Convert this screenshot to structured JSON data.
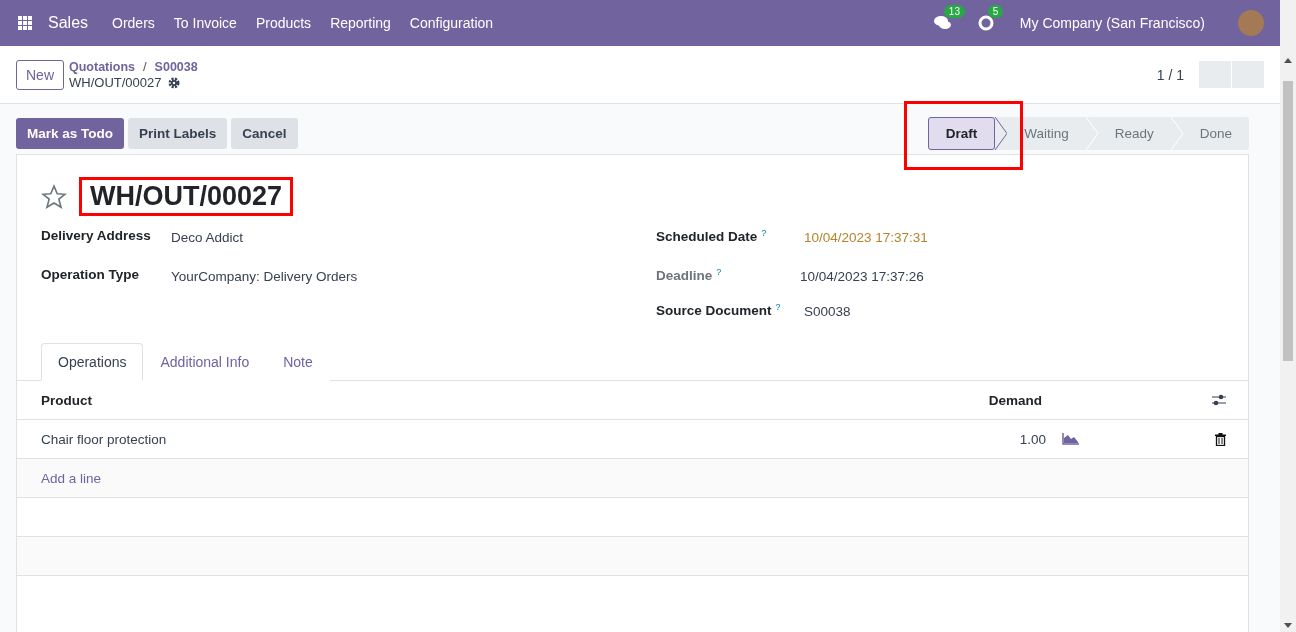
{
  "navbar": {
    "app": "Sales",
    "menu": [
      "Orders",
      "To Invoice",
      "Products",
      "Reporting",
      "Configuration"
    ],
    "messages_badge": "13",
    "activities_badge": "5",
    "company": "My Company (San Francisco)"
  },
  "control_panel": {
    "new_button": "New",
    "breadcrumbs": [
      "Quotations",
      "S00038"
    ],
    "breadcrumb_separator": "/",
    "record": "WH/OUT/00027",
    "pager": "1 / 1"
  },
  "actions": [
    "Mark as Todo",
    "Print Labels",
    "Cancel"
  ],
  "status_steps": [
    {
      "label": "Draft",
      "selected": true,
      "highlighted": true
    },
    {
      "label": "Waiting",
      "selected": false,
      "highlighted": false
    },
    {
      "label": "Ready",
      "selected": false,
      "highlighted": false
    },
    {
      "label": "Done",
      "selected": false,
      "highlighted": false
    }
  ],
  "sheet": {
    "title": "WH/OUT/00027",
    "title_highlighted": true,
    "starred": false,
    "left_fields": [
      {
        "label": "Delivery Address",
        "value": "Deco Addict"
      },
      {
        "label": "Operation Type",
        "value": "YourCompany: Delivery Orders"
      }
    ],
    "right_fields": [
      {
        "label": "Scheduled Date",
        "help": "?",
        "value": "10/04/2023 17:37:31",
        "kind": "warning"
      },
      {
        "label": "Deadline",
        "help": "?",
        "value": "10/04/2023 17:37:26",
        "kind": "muted"
      },
      {
        "label": "Source Document",
        "help": "?",
        "value": "S00038",
        "kind": "normal"
      }
    ],
    "tabs": [
      {
        "label": "Operations",
        "selected": true
      },
      {
        "label": "Additional Info",
        "selected": false
      },
      {
        "label": "Note",
        "selected": false
      }
    ],
    "table": {
      "columns": [
        "Product",
        "Demand"
      ],
      "rows": [
        {
          "product": "Chair floor protection",
          "demand": "1.00"
        }
      ],
      "add_line": "Add a line"
    }
  }
}
